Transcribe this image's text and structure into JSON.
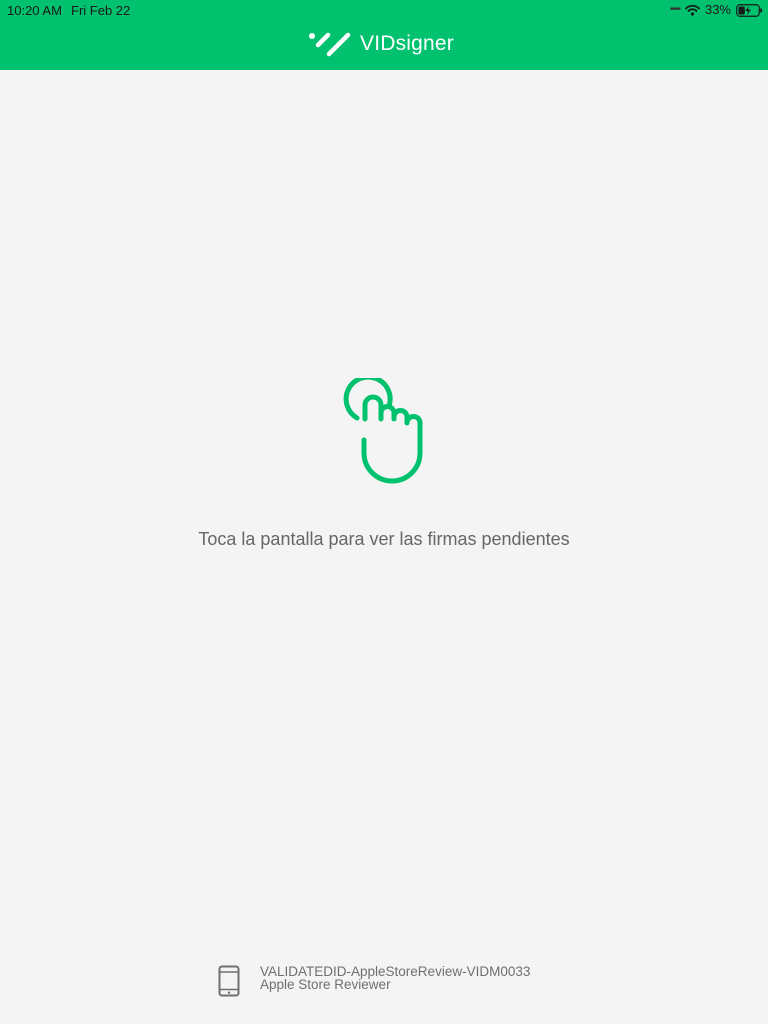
{
  "status_bar": {
    "time": "10:20 AM",
    "date": "Fri Feb 22",
    "battery_percent": "33%",
    "battery_level": 0.33,
    "charging": true,
    "icons": [
      "signal-dots-icon",
      "wifi-icon",
      "battery-charging-icon"
    ]
  },
  "header": {
    "brand_name": "VIDsigner",
    "logo_icon": "vidsigner-logo-icon",
    "background_color": "#00c16e"
  },
  "main": {
    "tap_icon": "tap-hand-icon",
    "accent_color": "#00c16e",
    "instruction": "Toca la pantalla para ver las firmas pendientes"
  },
  "footer": {
    "device_icon": "tablet-icon",
    "device_id": "VALIDATEDID-AppleStoreReview-VIDM0033",
    "user_name": "Apple Store Reviewer"
  }
}
